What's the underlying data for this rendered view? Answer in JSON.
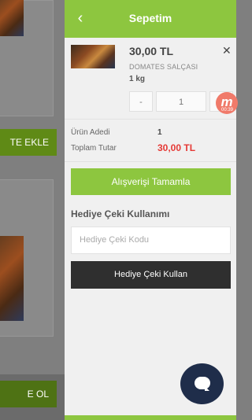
{
  "background": {
    "button_top_label": "TE EKLE",
    "button_bottom_label": "E OL"
  },
  "header": {
    "back_icon": "chevron-left-icon",
    "title": "Sepetim"
  },
  "cart_item": {
    "price": "30,00 TL",
    "name": "DOMATES SALÇASI",
    "unit": "1 kg",
    "remove_icon": "close-icon",
    "qty_minus": "-",
    "qty_value": "1",
    "qty_plus": "+"
  },
  "overlay_badge": {
    "letter": "m",
    "time": "00:39"
  },
  "summary": {
    "count_label": "Ürün Adedi",
    "count_value": "1",
    "total_label": "Toplam Tutar",
    "total_value": "30,00 TL"
  },
  "checkout_label": "Alışverişi Tamamla",
  "gift": {
    "title": "Hediye Çeki Kullanımı",
    "placeholder": "Hediye Çeki Kodu",
    "button_label": "Hediye Çeki Kullan"
  },
  "colors": {
    "accent": "#8dc63f",
    "total_red": "#e53935",
    "dark_button": "#2f2f2f",
    "chat_fab": "#1f2d4a"
  }
}
